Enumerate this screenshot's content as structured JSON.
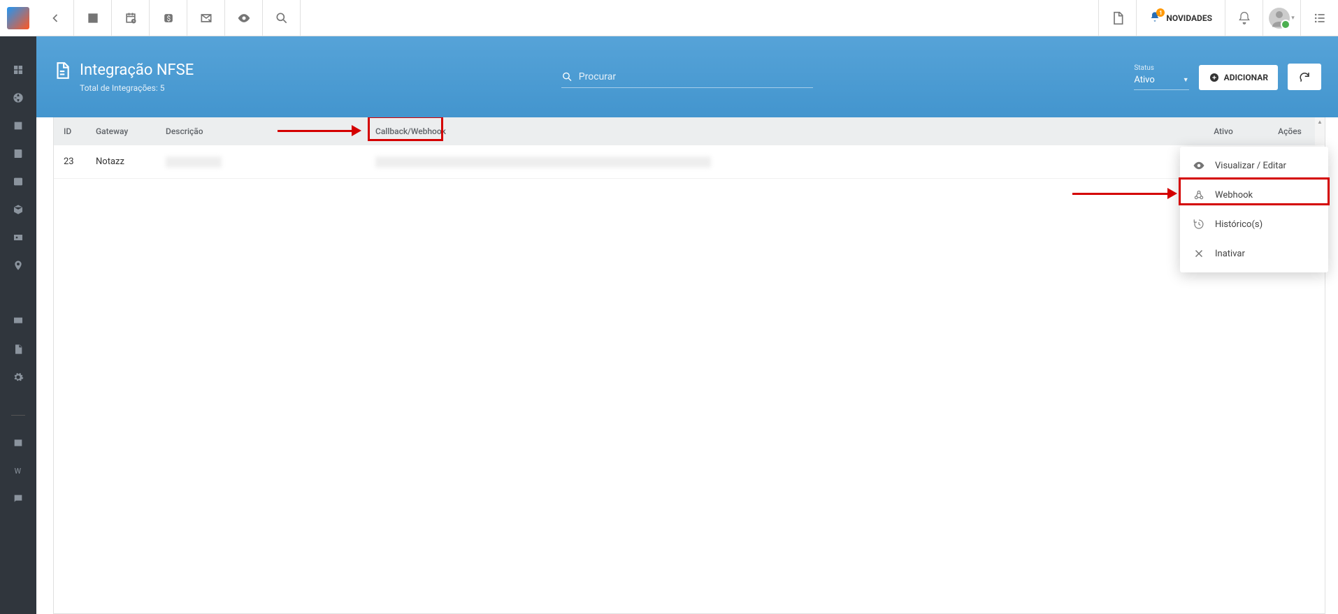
{
  "topbar": {
    "novidades_label": "NOVIDADES",
    "novidades_badge": "1"
  },
  "header": {
    "title": "Integração NFSE",
    "subtitle": "Total de Integrações: 5",
    "search_placeholder": "Procurar",
    "status_label": "Status",
    "status_value": "Ativo",
    "add_button": "ADICIONAR"
  },
  "table": {
    "columns": {
      "id": "ID",
      "gateway": "Gateway",
      "descricao": "Descrição",
      "callback": "Callback/Webhook",
      "ativo": "Ativo",
      "acoes": "Ações"
    },
    "rows": [
      {
        "id": "23",
        "gateway": "Notazz",
        "descricao": "",
        "callback": ""
      }
    ]
  },
  "context_menu": {
    "view_edit": "Visualizar / Editar",
    "webhook": "Webhook",
    "historico": "Histórico(s)",
    "inativar": "Inativar"
  }
}
